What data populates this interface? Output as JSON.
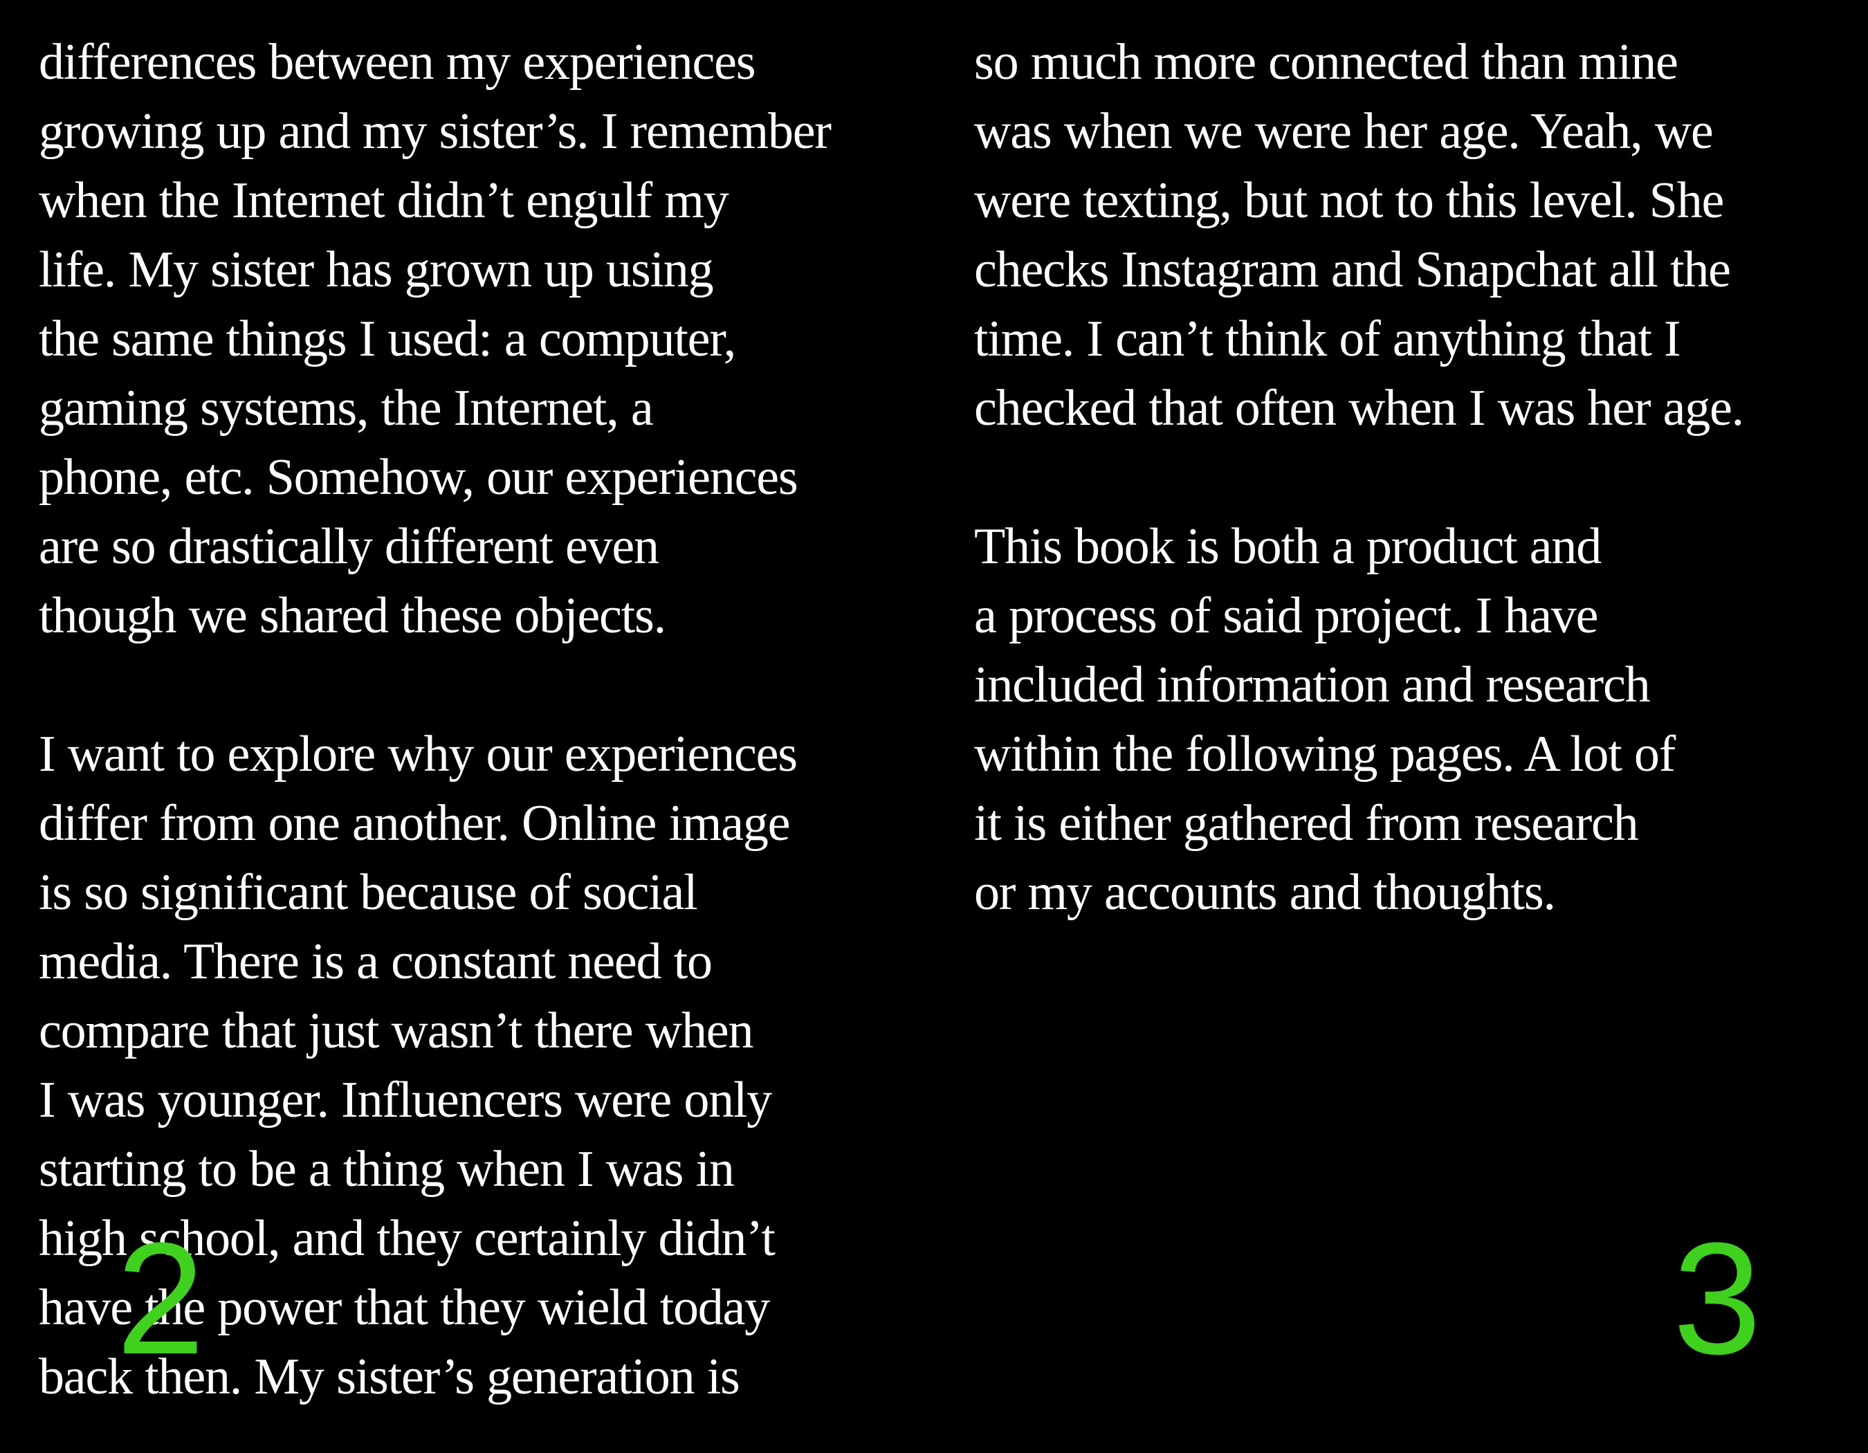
{
  "colors": {
    "background": "#000000",
    "text": "#ffffff",
    "page_number": "#3fd11e"
  },
  "left_page": {
    "paragraphs": [
      {
        "lines": [
          "differences between my experiences",
          "growing up and my sister’s. I remember",
          "when the Internet didn’t engulf my",
          "life. My sister has grown up using",
          "the same things I used: a computer,",
          "gaming systems, the Internet, a",
          "phone, etc. Somehow, our experiences",
          "are so drastically different even",
          "though we shared these objects."
        ]
      },
      {
        "lines": [
          "I want to explore why our experiences",
          "differ from one another. Online image",
          "is so significant because of social",
          "media. There is a constant need to",
          "compare that just wasn’t there when",
          "I was younger. Influencers were only",
          "starting to be a thing when I was in",
          "high school, and they certainly didn’t",
          "have the power that they wield today",
          "back then. My sister’s generation is"
        ]
      }
    ],
    "page_number": "2"
  },
  "right_page": {
    "paragraphs": [
      {
        "lines": [
          "so much more connected than mine",
          "was when we were her age. Yeah, we",
          "were texting, but not to this level. She",
          "checks Instagram and Snapchat all the",
          "time. I can’t think of anything that I",
          "checked that often when I was her age."
        ]
      },
      {
        "lines": [
          "This book is both a product and",
          "a process of said project. I have",
          "included information and research",
          "within the following pages. A lot of",
          "it is either gathered from research",
          "or my accounts and thoughts."
        ]
      }
    ],
    "page_number": "3"
  }
}
